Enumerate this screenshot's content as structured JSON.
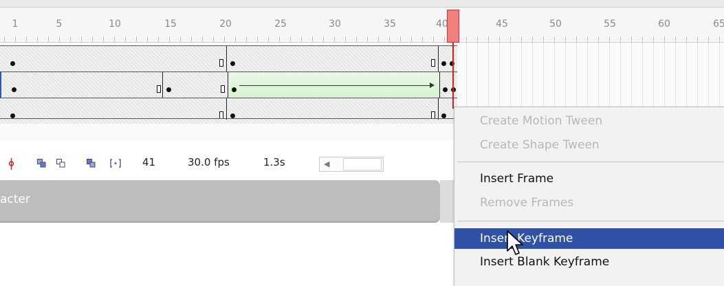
{
  "timeline": {
    "ruler_numbers": [
      "1",
      "5",
      "10",
      "15",
      "20",
      "25",
      "30",
      "35",
      "40",
      "45",
      "50",
      "55",
      "60",
      "65"
    ],
    "current_frame": "41",
    "frame_rate": "30.0 fps",
    "elapsed_time": "1.3s"
  },
  "panel": {
    "title": "acter"
  },
  "context_menu": {
    "items": [
      {
        "label": "Create Motion Tween",
        "enabled": false
      },
      {
        "label": "Create Shape Tween",
        "enabled": false
      },
      {
        "label": "Insert Frame",
        "enabled": true
      },
      {
        "label": "Remove Frames",
        "enabled": false
      },
      {
        "label": "Insert Keyframe",
        "enabled": true,
        "highlighted": true
      },
      {
        "label": "Insert Blank Keyframe",
        "enabled": true
      }
    ]
  },
  "colors": {
    "playhead": "#f07f7f",
    "menu_highlight": "#2f52a6",
    "tween_fill": "#e0f7dc"
  },
  "icons": [
    "playhead-marker-icon",
    "onion-skin-icon",
    "onion-skin-outline-icon",
    "edit-multiple-frames-icon",
    "modify-onion-markers-icon",
    "scroll-left-icon",
    "mouse-pointer-icon"
  ]
}
